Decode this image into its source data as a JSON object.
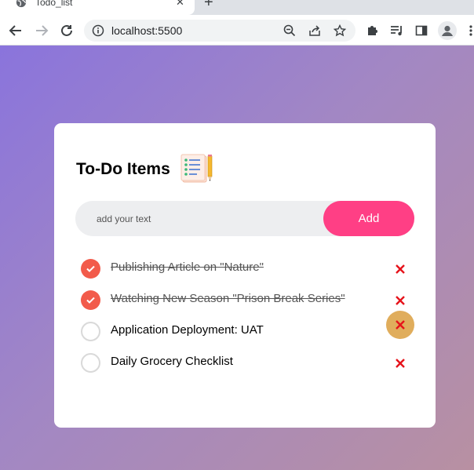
{
  "browser": {
    "tab_title": "Todo_list",
    "url": "localhost:5500"
  },
  "app": {
    "title": "To-Do Items",
    "title_emoji": "notepad-pencil-emoji",
    "input_placeholder": "add your text",
    "input_value": "",
    "add_label": "Add"
  },
  "todos": [
    {
      "text": "Publishing Article on \"Nature\"",
      "done": true
    },
    {
      "text": "Watching New Season \"Prison Break Series\"",
      "done": true
    },
    {
      "text": "Application Deployment: UAT",
      "done": false,
      "hovered": true
    },
    {
      "text": "Daily Grocery Checklist",
      "done": false
    }
  ],
  "colors": {
    "accent": "#ff3f85",
    "check": "#f25b4b",
    "delete": "#e6131b",
    "delete_hover_bg": "#e0ad5c"
  }
}
